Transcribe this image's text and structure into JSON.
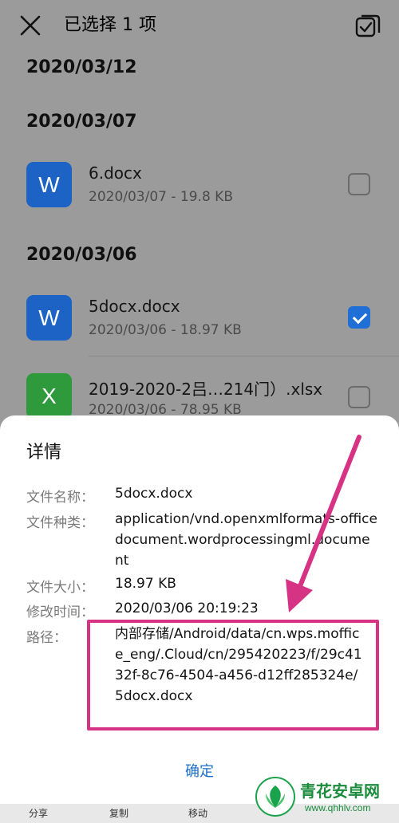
{
  "topbar": {
    "title": "已选择 1 项",
    "close_icon": "close-icon",
    "select_all_icon": "select-all-icon"
  },
  "groups": [
    {
      "date": "2020/03/12"
    },
    {
      "date": "2020/03/07"
    },
    {
      "date": "2020/03/06"
    }
  ],
  "files": [
    {
      "icon_letter": "W",
      "type": "word",
      "name": "6.docx",
      "meta": "2020/03/07 - 19.8 KB",
      "checked": false
    },
    {
      "icon_letter": "W",
      "type": "word",
      "name": "5docx.docx",
      "meta": "2020/03/06 - 18.97 KB",
      "checked": true
    },
    {
      "icon_letter": "X",
      "type": "excel",
      "name": "2019-2020-2吕…214门）.xlsx",
      "meta": "2020/03/06 - 78.95 KB",
      "checked": false
    }
  ],
  "dialog": {
    "title": "详情",
    "rows": [
      {
        "label": "文件名称：",
        "value": "5docx.docx"
      },
      {
        "label": "文件种类：",
        "value": "application/vnd.openxmlformats-officedocument.wordprocessingml.document"
      },
      {
        "label": "文件大小：",
        "value": "18.97 KB"
      },
      {
        "label": "修改时间：",
        "value": "2020/03/06 20:19:23"
      },
      {
        "label": "路径：",
        "value": "内部存储/Android/data/cn.wps.moffice_eng/.Cloud/cn/295420223/f/29c4132f-8c76-4504-a456-d12ff285324e/5docx.docx"
      }
    ],
    "confirm_label": "确定"
  },
  "bottom_bar": {
    "items": [
      "分享",
      "复制",
      "移动"
    ]
  },
  "watermark": {
    "name": "青花安卓网",
    "url": "www.qhhlv.com"
  },
  "colors": {
    "accent": "#1a6ec8",
    "highlight": "#d63384",
    "word": "#1c63c5",
    "excel": "#2e9a3c"
  }
}
